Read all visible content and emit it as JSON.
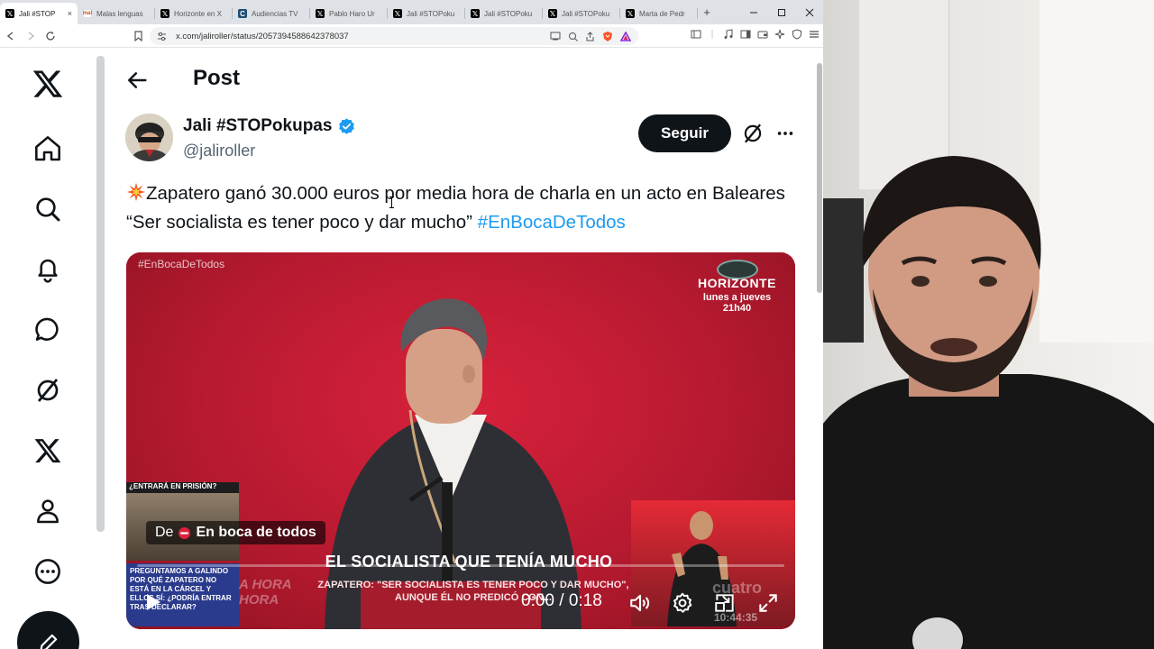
{
  "browser": {
    "tabs": [
      {
        "label": "Jali #STOP",
        "favicon": "x",
        "active": true
      },
      {
        "label": "Malas lenguas",
        "favicon": "m",
        "active": false
      },
      {
        "label": "Horizonte en X",
        "favicon": "x",
        "active": false
      },
      {
        "label": "Audiencias TV",
        "favicon": "c",
        "active": false
      },
      {
        "label": "Pablo Haro Ur",
        "favicon": "x",
        "active": false
      },
      {
        "label": "Jali #STOPoku",
        "favicon": "x",
        "active": false
      },
      {
        "label": "Jali #STOPoku",
        "favicon": "x",
        "active": false
      },
      {
        "label": "Jali #STOPoku",
        "favicon": "x",
        "active": false
      },
      {
        "label": "Marta de Pedr",
        "favicon": "x",
        "active": false
      }
    ],
    "url": "x.com/jaliroller/status/2057394588642378037",
    "new_tab_glyph": "+",
    "accent_color": "#1d9bf0"
  },
  "post": {
    "header": "Post",
    "author": {
      "display_name": "Jali #STOPokupas",
      "handle": "@jaliroller",
      "verified": true
    },
    "follow_label": "Seguir",
    "text": "Zapatero ganó 30.000 euros por media hora de charla en un acto en Baleares “Ser socialista es tener poco y dar mucho” ",
    "hashtag": "#EnBocaDeTodos"
  },
  "video": {
    "overlay_tag": "#EnBocaDeTodos",
    "logo_title": "HORIZONTE",
    "logo_schedule": "lunes a jueves 21h40",
    "side_label": "¿ENTRARÁ EN PRISIÓN?",
    "side_text": "PREGUNTAMOS A GALINDO POR QUÉ ZAPATERO NO ESTÁ EN LA CÁRCEL Y ELLOS SÍ: ¿PODRÍA ENTRAR TRAS DECLARAR?",
    "hora_text": "A HORA\nHORA",
    "headline": "EL SOCIALISTA QUE TENÍA MUCHO",
    "subline": "ZAPATERO: \"SER SOCIALISTA ES TENER POCO Y DAR MUCHO\", AUNQUE ÉL NO PREDICÓ CON...",
    "watermark": "cuatro",
    "clock": "10:44:35",
    "source_prefix": "De",
    "source_name": "En boca de todos",
    "time": "0:00 / 0:18",
    "progress": 0
  }
}
